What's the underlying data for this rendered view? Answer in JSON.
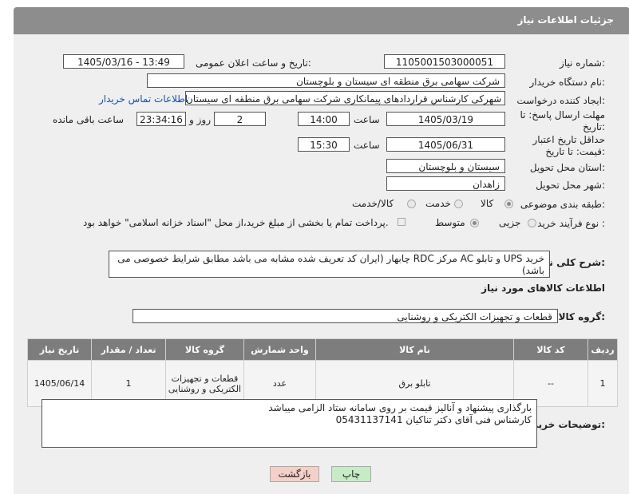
{
  "header": {
    "title": "جزئیات اطلاعات نیاز"
  },
  "need_number": {
    "label": "شماره نیاز:",
    "value": "1105001503000051"
  },
  "announce_datetime": {
    "label": "تاریخ و ساعت اعلان عمومی:",
    "value": "1405/03/16 - 13:49"
  },
  "buyer_org": {
    "label": "نام دستگاه خریدار:",
    "value": "شرکت سهامی برق منطقه ای سیستان و بلوچستان"
  },
  "requester": {
    "label": "ایجاد کننده درخواست:",
    "value": "لیلا شهرکی کارشناس قراردادهای پیمانکاری شرکت سهامی برق منطقه ای سیستان",
    "contact_link": "اطلاعات تماس خریدار"
  },
  "reply_deadline": {
    "label": "مهلت ارسال پاسخ: تا تاریخ:",
    "date": "1405/03/19",
    "time_label": "ساعت",
    "time": "14:00",
    "days": "2",
    "days_label": "روز و",
    "remaining": "23:34:16",
    "remaining_label": "ساعت باقی مانده"
  },
  "price_validity": {
    "label": "حداقل تاریخ اعتبار قیمت: تا تاریخ:",
    "date": "1405/06/31",
    "time_label": "ساعت",
    "time": "15:30"
  },
  "delivery_province": {
    "label": "استان محل تحویل:",
    "value": "سیستان و بلوچستان"
  },
  "delivery_city": {
    "label": "شهر محل تحویل:",
    "value": "زاهدان"
  },
  "category": {
    "label": "طبقه بندی موضوعی:",
    "options": [
      "کالا",
      "خدمت",
      "کالا/خدمت"
    ],
    "selected": "کالا"
  },
  "purchase_type": {
    "label": "نوع فرآیند خرید :",
    "options": [
      "جزیی",
      "متوسط"
    ],
    "selected": "متوسط",
    "note": "پرداخت تمام یا بخشی از مبلغ خرید،از محل \"اسناد خزانه اسلامی\" خواهد بود."
  },
  "description": {
    "label": "شرح کلی نیاز:",
    "value": "خرید UPS و تابلو AC مرکز RDC چابهار (ایران کد تعریف شده مشابه می باشد مطابق شرایط خصوصی می باشد)"
  },
  "goods_info": {
    "title": "اطلاعات کالاهای مورد نیاز"
  },
  "goods_group": {
    "label": "گروه کالا:",
    "value": "قطعات و تجهیزات الکتریکی و روشنایی"
  },
  "table": {
    "headers": [
      "ردیف",
      "کد کالا",
      "نام کالا",
      "واحد شمارش",
      "گروه کالا",
      "تعداد / مقدار",
      "تاریخ نیاز"
    ],
    "rows": [
      [
        "1",
        "--",
        "تابلو برق",
        "عدد",
        "قطعات و تجهیزات الکتریکی و روشنایی",
        "1",
        "1405/06/14"
      ]
    ]
  },
  "buyer_notes": {
    "label": "توضیحات خریدار:",
    "line1": "بارگذاری پیشنهاد و آنالیز قیمت بر روی سامانه ستاد الزامی میباشد",
    "line2": "کارشناس فنی آقای دکتر تناکیان 05431137141"
  },
  "buttons": {
    "print": "چاپ",
    "back": "بازگشت"
  },
  "colors": {
    "header_bg": "#8d8d8d",
    "table_header_bg": "#7d7d7d",
    "link": "#1a4fa0",
    "back_button": "#f4d0c8",
    "print_button": "#c5ecc5"
  }
}
